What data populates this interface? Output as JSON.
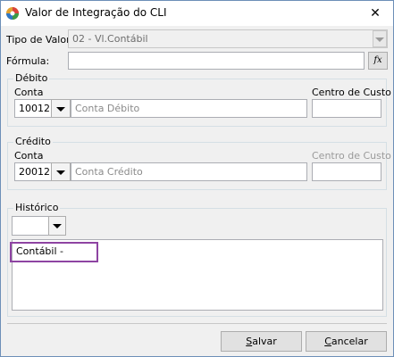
{
  "window": {
    "title": "Valor de Integração do CLI",
    "close_glyph": "✕"
  },
  "tipo_valor": {
    "label": "Tipo de Valor:",
    "value": "02 - Vl.Contábil"
  },
  "formula": {
    "label": "Fórmula:",
    "value": "",
    "button_label": "fx"
  },
  "debito": {
    "group_label": "Débito",
    "conta_label": "Conta",
    "conta_code": "10012",
    "conta_desc": "Conta Débito",
    "centro_label": "Centro de Custo",
    "centro_value": ""
  },
  "credito": {
    "group_label": "Crédito",
    "conta_label": "Conta",
    "conta_code": "20012",
    "conta_desc": "Conta Crédito",
    "centro_label": "Centro de Custo",
    "centro_value": ""
  },
  "historico": {
    "group_label": "Histórico",
    "select_value": "",
    "text": "Contábil -"
  },
  "buttons": {
    "salvar_first": "S",
    "salvar_rest": "alvar",
    "cancelar_first": "C",
    "cancelar_rest": "ancelar"
  },
  "colors": {
    "highlight": "#8e44a2",
    "window_border": "#6d8fb8"
  }
}
